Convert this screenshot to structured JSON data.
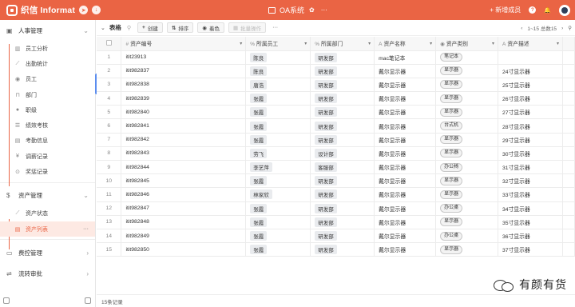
{
  "topbar": {
    "logo": "织信 Informat",
    "app_title": "OA系统",
    "new_member": "+ 新增成员",
    "help": "?",
    "bell": "🔔"
  },
  "sidebar": {
    "groups": [
      {
        "label": "人事管理",
        "icon": "person-card-icon"
      },
      {
        "label": "资产管理",
        "icon": "dollar-icon"
      },
      {
        "label": "费控管理",
        "icon": "wallet-icon"
      },
      {
        "label": "流转审批",
        "icon": "flow-icon"
      }
    ],
    "hr_items": [
      {
        "label": "员工分析",
        "icon": "chart-icon"
      },
      {
        "label": "出勤统计",
        "icon": "line-chart-icon"
      },
      {
        "label": "员工",
        "icon": "user-icon"
      },
      {
        "label": "部门",
        "icon": "org-icon"
      },
      {
        "label": "职级",
        "icon": "dot-icon"
      },
      {
        "label": "绩效考核",
        "icon": "list-icon"
      },
      {
        "label": "考勤信息",
        "icon": "table-icon"
      },
      {
        "label": "调薪记录",
        "icon": "yen-icon"
      },
      {
        "label": "奖惩记录",
        "icon": "badge-icon"
      }
    ],
    "asset_items": [
      {
        "label": "资产状态",
        "icon": "line-chart-icon"
      },
      {
        "label": "资产列表",
        "icon": "table-icon"
      }
    ]
  },
  "toolbar": {
    "title": "表格",
    "create": "创建",
    "sort": "排序",
    "color": "着色",
    "batch": "批量操作",
    "more": "···",
    "pagination": "1~15 总数15"
  },
  "table": {
    "headers": [
      "资产编号",
      "所属员工",
      "所属部门",
      "资产名称",
      "资产类别",
      "资产描述"
    ],
    "rows": [
      {
        "no": "1",
        "id": "itit23913",
        "emp": "陈良",
        "dept": "研发部",
        "name": "mac笔记本",
        "cat": "笔记本",
        "desc": ""
      },
      {
        "no": "2",
        "id": "itit982837",
        "emp": "陈良",
        "dept": "研发部",
        "name": "戴尔显示器",
        "cat": "显示器",
        "desc": "24寸显示器"
      },
      {
        "no": "3",
        "id": "itit982838",
        "emp": "唐浩",
        "dept": "研发部",
        "name": "戴尔显示器",
        "cat": "显示器",
        "desc": "25寸显示器"
      },
      {
        "no": "4",
        "id": "itit982839",
        "emp": "张霞",
        "dept": "研发部",
        "name": "戴尔显示器",
        "cat": "显示器",
        "desc": "26寸显示器"
      },
      {
        "no": "5",
        "id": "itit982840",
        "emp": "张霞",
        "dept": "研发部",
        "name": "戴尔显示器",
        "cat": "显示器",
        "desc": "27寸显示器"
      },
      {
        "no": "6",
        "id": "itit982841",
        "emp": "张霞",
        "dept": "研发部",
        "name": "戴尔显示器",
        "cat": "台式机",
        "desc": "28寸显示器"
      },
      {
        "no": "7",
        "id": "itit982842",
        "emp": "张霞",
        "dept": "研发部",
        "name": "戴尔显示器",
        "cat": "显示器",
        "desc": "29寸显示器"
      },
      {
        "no": "8",
        "id": "itit982843",
        "emp": "劳飞",
        "dept": "设计部",
        "name": "戴尔显示器",
        "cat": "显示器",
        "desc": "30寸显示器"
      },
      {
        "no": "9",
        "id": "itit982844",
        "emp": "李艺萍",
        "dept": "客服部",
        "name": "戴尔显示器",
        "cat": "办公椅",
        "desc": "31寸显示器"
      },
      {
        "no": "10",
        "id": "itit982845",
        "emp": "张霞",
        "dept": "研发部",
        "name": "戴尔显示器",
        "cat": "显示器",
        "desc": "32寸显示器"
      },
      {
        "no": "11",
        "id": "itit982846",
        "emp": "林家欣",
        "dept": "研发部",
        "name": "戴尔显示器",
        "cat": "显示器",
        "desc": "33寸显示器"
      },
      {
        "no": "12",
        "id": "itit982847",
        "emp": "张霞",
        "dept": "研发部",
        "name": "戴尔显示器",
        "cat": "办公桌",
        "desc": "34寸显示器"
      },
      {
        "no": "13",
        "id": "itit982848",
        "emp": "张霞",
        "dept": "研发部",
        "name": "戴尔显示器",
        "cat": "显示器",
        "desc": "35寸显示器"
      },
      {
        "no": "14",
        "id": "itit982849",
        "emp": "张霞",
        "dept": "研发部",
        "name": "戴尔显示器",
        "cat": "办公桌",
        "desc": "36寸显示器"
      },
      {
        "no": "15",
        "id": "itit982850",
        "emp": "张霞",
        "dept": "研发部",
        "name": "戴尔显示器",
        "cat": "显示器",
        "desc": "37寸显示器"
      }
    ]
  },
  "footer": {
    "count": "15条记录"
  },
  "watermark": {
    "text": "有颜有货"
  }
}
